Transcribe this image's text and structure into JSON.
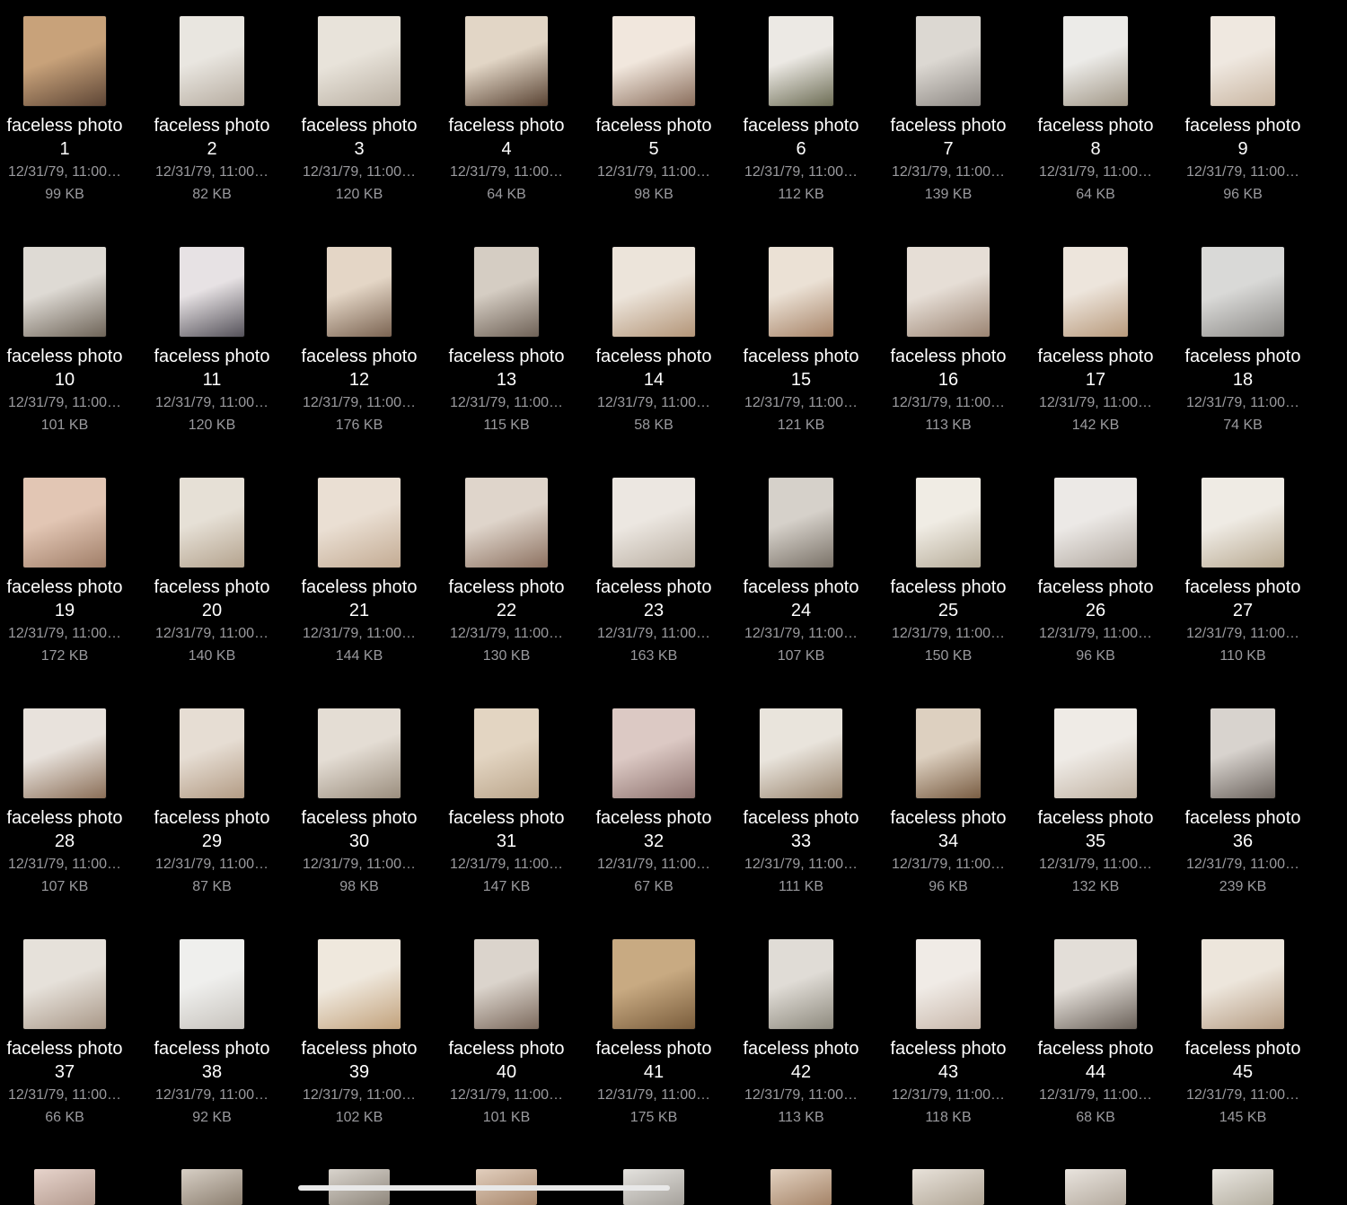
{
  "files": [
    {
      "name": "faceless photo",
      "num": "1",
      "date": "12/31/79, 11:00…",
      "size": "99 KB",
      "c1": "#c8a27a",
      "c2": "#5e4636",
      "w": "land"
    },
    {
      "name": "faceless photo",
      "num": "2",
      "date": "12/31/79, 11:00…",
      "size": "82 KB",
      "c1": "#e9e6e0",
      "c2": "#b7ada1",
      "w": "portrait"
    },
    {
      "name": "faceless photo",
      "num": "3",
      "date": "12/31/79, 11:00…",
      "size": "120 KB",
      "c1": "#e8e3da",
      "c2": "#b9afa2",
      "w": "land"
    },
    {
      "name": "faceless photo",
      "num": "4",
      "date": "12/31/79, 11:00…",
      "size": "64 KB",
      "c1": "#e2d6c6",
      "c2": "#5a4434",
      "w": "land"
    },
    {
      "name": "faceless photo",
      "num": "5",
      "date": "12/31/79, 11:00…",
      "size": "98 KB",
      "c1": "#f1e7dd",
      "c2": "#8a6e5c",
      "w": "land"
    },
    {
      "name": "faceless photo",
      "num": "6",
      "date": "12/31/79, 11:00…",
      "size": "112 KB",
      "c1": "#ece9e4",
      "c2": "#6d6d55",
      "w": "portrait"
    },
    {
      "name": "faceless photo",
      "num": "7",
      "date": "12/31/79, 11:00…",
      "size": "139 KB",
      "c1": "#dcd8d2",
      "c2": "#8f8a85",
      "w": "portrait"
    },
    {
      "name": "faceless photo",
      "num": "8",
      "date": "12/31/79, 11:00…",
      "size": "64 KB",
      "c1": "#ecebe8",
      "c2": "#a29888",
      "w": "portrait"
    },
    {
      "name": "faceless photo",
      "num": "9",
      "date": "12/31/79, 11:00…",
      "size": "96 KB",
      "c1": "#efe8e0",
      "c2": "#c9b6a2",
      "w": "portrait"
    },
    {
      "name": "faceless photo",
      "num": "10",
      "date": "12/31/79, 11:00…",
      "size": "101 KB",
      "c1": "#dedad4",
      "c2": "#6e6458",
      "w": "land"
    },
    {
      "name": "faceless photo",
      "num": "11",
      "date": "12/31/79, 11:00…",
      "size": "120 KB",
      "c1": "#e7e2e4",
      "c2": "#55525a",
      "w": "portrait"
    },
    {
      "name": "faceless photo",
      "num": "12",
      "date": "12/31/79, 11:00…",
      "size": "176 KB",
      "c1": "#e4d6c6",
      "c2": "#7b6452",
      "w": "portrait"
    },
    {
      "name": "faceless photo",
      "num": "13",
      "date": "12/31/79, 11:00…",
      "size": "115 KB",
      "c1": "#d5cdc3",
      "c2": "#6f6257",
      "w": "portrait"
    },
    {
      "name": "faceless photo",
      "num": "14",
      "date": "12/31/79, 11:00…",
      "size": "58 KB",
      "c1": "#ece4da",
      "c2": "#b39578",
      "w": "land"
    },
    {
      "name": "faceless photo",
      "num": "15",
      "date": "12/31/79, 11:00…",
      "size": "121 KB",
      "c1": "#ebe1d5",
      "c2": "#a78468",
      "w": "portrait"
    },
    {
      "name": "faceless photo",
      "num": "16",
      "date": "12/31/79, 11:00…",
      "size": "113 KB",
      "c1": "#e6ded6",
      "c2": "#9b8472",
      "w": "land"
    },
    {
      "name": "faceless photo",
      "num": "17",
      "date": "12/31/79, 11:00…",
      "size": "142 KB",
      "c1": "#ede5dc",
      "c2": "#b89a7c",
      "w": "portrait"
    },
    {
      "name": "faceless photo",
      "num": "18",
      "date": "12/31/79, 11:00…",
      "size": "74 KB",
      "c1": "#d9d9d7",
      "c2": "#8c8a87",
      "w": "land"
    },
    {
      "name": "faceless photo",
      "num": "19",
      "date": "12/31/79, 11:00…",
      "size": "172 KB",
      "c1": "#e2c6b4",
      "c2": "#a07e68",
      "w": "land"
    },
    {
      "name": "faceless photo",
      "num": "20",
      "date": "12/31/79, 11:00…",
      "size": "140 KB",
      "c1": "#e6e0d6",
      "c2": "#b4a38e",
      "w": "portrait"
    },
    {
      "name": "faceless photo",
      "num": "21",
      "date": "12/31/79, 11:00…",
      "size": "144 KB",
      "c1": "#eadfd3",
      "c2": "#c3ab93",
      "w": "land"
    },
    {
      "name": "faceless photo",
      "num": "22",
      "date": "12/31/79, 11:00…",
      "size": "130 KB",
      "c1": "#dfd5cb",
      "c2": "#8d7261",
      "w": "land"
    },
    {
      "name": "faceless photo",
      "num": "23",
      "date": "12/31/79, 11:00…",
      "size": "163 KB",
      "c1": "#ece7e1",
      "c2": "#b9aea1",
      "w": "land"
    },
    {
      "name": "faceless photo",
      "num": "24",
      "date": "12/31/79, 11:00…",
      "size": "107 KB",
      "c1": "#d6d1ca",
      "c2": "#7a7268",
      "w": "portrait"
    },
    {
      "name": "faceless photo",
      "num": "25",
      "date": "12/31/79, 11:00…",
      "size": "150 KB",
      "c1": "#f0ece4",
      "c2": "#b7ad9a",
      "w": "portrait"
    },
    {
      "name": "faceless photo",
      "num": "26",
      "date": "12/31/79, 11:00…",
      "size": "96 KB",
      "c1": "#ece9e6",
      "c2": "#b0a79e",
      "w": "land"
    },
    {
      "name": "faceless photo",
      "num": "27",
      "date": "12/31/79, 11:00…",
      "size": "110 KB",
      "c1": "#efebe4",
      "c2": "#b7a890",
      "w": "land"
    },
    {
      "name": "faceless photo",
      "num": "28",
      "date": "12/31/79, 11:00…",
      "size": "107 KB",
      "c1": "#e8e2dc",
      "c2": "#8b6f58",
      "w": "land"
    },
    {
      "name": "faceless photo",
      "num": "29",
      "date": "12/31/79, 11:00…",
      "size": "87 KB",
      "c1": "#e6ddd3",
      "c2": "#b39c85",
      "w": "portrait"
    },
    {
      "name": "faceless photo",
      "num": "30",
      "date": "12/31/79, 11:00…",
      "size": "98 KB",
      "c1": "#e4ddd4",
      "c2": "#9b8e7e",
      "w": "land"
    },
    {
      "name": "faceless photo",
      "num": "31",
      "date": "12/31/79, 11:00…",
      "size": "147 KB",
      "c1": "#e3d5c2",
      "c2": "#bba68c",
      "w": "portrait"
    },
    {
      "name": "faceless photo",
      "num": "32",
      "date": "12/31/79, 11:00…",
      "size": "67 KB",
      "c1": "#dcc9c4",
      "c2": "#8f7470",
      "w": "land"
    },
    {
      "name": "faceless photo",
      "num": "33",
      "date": "12/31/79, 11:00…",
      "size": "111 KB",
      "c1": "#e9e4dc",
      "c2": "#9a8670",
      "w": "land"
    },
    {
      "name": "faceless photo",
      "num": "34",
      "date": "12/31/79, 11:00…",
      "size": "96 KB",
      "c1": "#ddd0c0",
      "c2": "#7a5e44",
      "w": "portrait"
    },
    {
      "name": "faceless photo",
      "num": "35",
      "date": "12/31/79, 11:00…",
      "size": "132 KB",
      "c1": "#efebe6",
      "c2": "#c0b2a2",
      "w": "land"
    },
    {
      "name": "faceless photo",
      "num": "36",
      "date": "12/31/79, 11:00…",
      "size": "239 KB",
      "c1": "#d8d3ce",
      "c2": "#6e6660",
      "w": "portrait"
    },
    {
      "name": "faceless photo",
      "num": "37",
      "date": "12/31/79, 11:00…",
      "size": "66 KB",
      "c1": "#e6e1da",
      "c2": "#a99888",
      "w": "land"
    },
    {
      "name": "faceless photo",
      "num": "38",
      "date": "12/31/79, 11:00…",
      "size": "92 KB",
      "c1": "#efefed",
      "c2": "#c7c3bd",
      "w": "portrait"
    },
    {
      "name": "faceless photo",
      "num": "39",
      "date": "12/31/79, 11:00…",
      "size": "102 KB",
      "c1": "#efe8dd",
      "c2": "#c2a27c",
      "w": "land"
    },
    {
      "name": "faceless photo",
      "num": "40",
      "date": "12/31/79, 11:00…",
      "size": "101 KB",
      "c1": "#dbd4cc",
      "c2": "#7d6b5e",
      "w": "portrait"
    },
    {
      "name": "faceless photo",
      "num": "41",
      "date": "12/31/79, 11:00…",
      "size": "175 KB",
      "c1": "#c8aa82",
      "c2": "#7a5d3c",
      "w": "land"
    },
    {
      "name": "faceless photo",
      "num": "42",
      "date": "12/31/79, 11:00…",
      "size": "113 KB",
      "c1": "#e0dcd6",
      "c2": "#8e8a7e",
      "w": "portrait"
    },
    {
      "name": "faceless photo",
      "num": "43",
      "date": "12/31/79, 11:00…",
      "size": "118 KB",
      "c1": "#f0ebe6",
      "c2": "#c8b8ab",
      "w": "portrait"
    },
    {
      "name": "faceless photo",
      "num": "44",
      "date": "12/31/79, 11:00…",
      "size": "68 KB",
      "c1": "#e3ded8",
      "c2": "#6b625a",
      "w": "land"
    },
    {
      "name": "faceless photo",
      "num": "45",
      "date": "12/31/79, 11:00…",
      "size": "145 KB",
      "c1": "#ede6dc",
      "c2": "#b59c83",
      "w": "land"
    }
  ],
  "partial_row": [
    {
      "c1": "#e7d4cc",
      "c2": "#b39a8e",
      "w": "portrait"
    },
    {
      "c1": "#d7cfc5",
      "c2": "#8c7f70",
      "w": "portrait"
    },
    {
      "c1": "#d9d4cd",
      "c2": "#8f877c",
      "w": "portrait"
    },
    {
      "c1": "#e2cfbe",
      "c2": "#a8876c",
      "w": "portrait"
    },
    {
      "c1": "#e4e2de",
      "c2": "#a6a29c",
      "w": "portrait"
    },
    {
      "c1": "#e3d2c1",
      "c2": "#a58468",
      "w": "portrait"
    },
    {
      "c1": "#e8e2da",
      "c2": "#b0a595",
      "w": "land"
    },
    {
      "c1": "#e9e4de",
      "c2": "#b4aa9e",
      "w": "portrait"
    },
    {
      "c1": "#e9e6e0",
      "c2": "#b3ad9f",
      "w": "portrait"
    }
  ]
}
